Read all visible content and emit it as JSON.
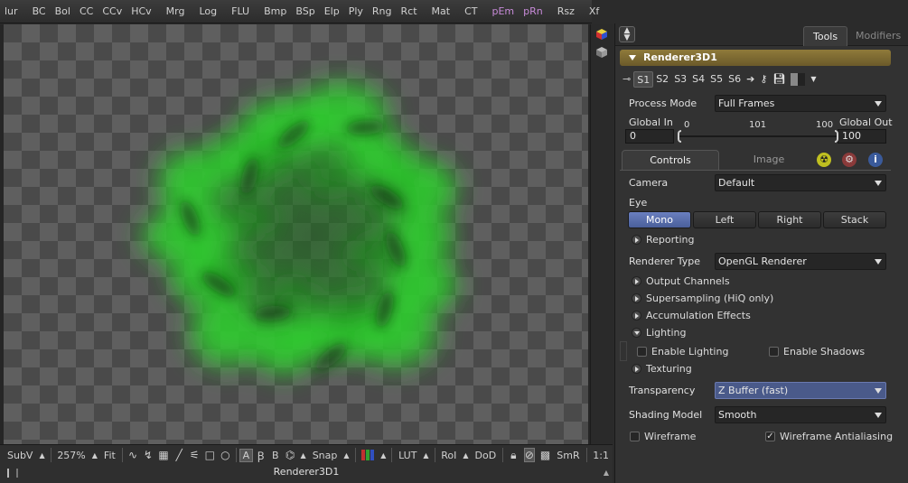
{
  "toolbar": {
    "items": [
      "lur",
      "BC",
      "Bol",
      "CC",
      "CCv",
      "HCv",
      "Mrg",
      "Log",
      "FLU",
      "Bmp",
      "BSp",
      "Elp",
      "Ply",
      "Rng",
      "Rct",
      "Mat",
      "CT",
      "pEm",
      "pRn",
      "Rsz",
      "Xf"
    ]
  },
  "viewer": {
    "name": "Renderer3D1",
    "bottom": {
      "subview": "SubV",
      "zoom": "257%",
      "fit": "Fit",
      "text_a": "A",
      "text_b": "B",
      "snap": "Snap",
      "lut": "LUT",
      "roi": "RoI",
      "dod": "DoD",
      "smr": "SmR",
      "one_to_one": "1:1"
    }
  },
  "panel": {
    "tabs": {
      "tools": "Tools",
      "modifiers": "Modifiers"
    },
    "tool_name": "Renderer3D1",
    "slots": [
      "S1",
      "S2",
      "S3",
      "S4",
      "S5",
      "S6"
    ],
    "process_mode": {
      "label": "Process Mode",
      "value": "Full Frames"
    },
    "global_in": {
      "label": "Global In",
      "value": "0"
    },
    "global_out": {
      "label": "Global Out",
      "value": "100"
    },
    "range": {
      "start": "0",
      "mid": "101",
      "end": "100"
    },
    "control_tabs": {
      "controls": "Controls",
      "image": "Image"
    },
    "camera": {
      "label": "Camera",
      "value": "Default"
    },
    "eye": {
      "label": "Eye",
      "options": [
        "Mono",
        "Left",
        "Right",
        "Stack"
      ],
      "selected": "Mono"
    },
    "reporting": "Reporting",
    "renderer_type": {
      "label": "Renderer Type",
      "value": "OpenGL Renderer"
    },
    "sections": {
      "output_channels": "Output Channels",
      "supersampling": "Supersampling (HiQ only)",
      "accumulation": "Accumulation Effects",
      "lighting": "Lighting",
      "texturing": "Texturing"
    },
    "enable_lighting": {
      "label": "Enable Lighting",
      "checked": false
    },
    "enable_shadows": {
      "label": "Enable Shadows",
      "checked": false
    },
    "transparency": {
      "label": "Transparency",
      "value": "Z Buffer (fast)"
    },
    "shading_model": {
      "label": "Shading Model",
      "value": "Smooth"
    },
    "wireframe": {
      "label": "Wireframe",
      "checked": false
    },
    "wireframe_aa": {
      "label": "Wireframe Antialiasing",
      "checked": true
    }
  },
  "colors": {
    "render_green": "#2fd02f",
    "tool_header": "#8f7a3a",
    "selected_blue": "#5a6fae",
    "highlight_pink": "#c78ad8"
  }
}
